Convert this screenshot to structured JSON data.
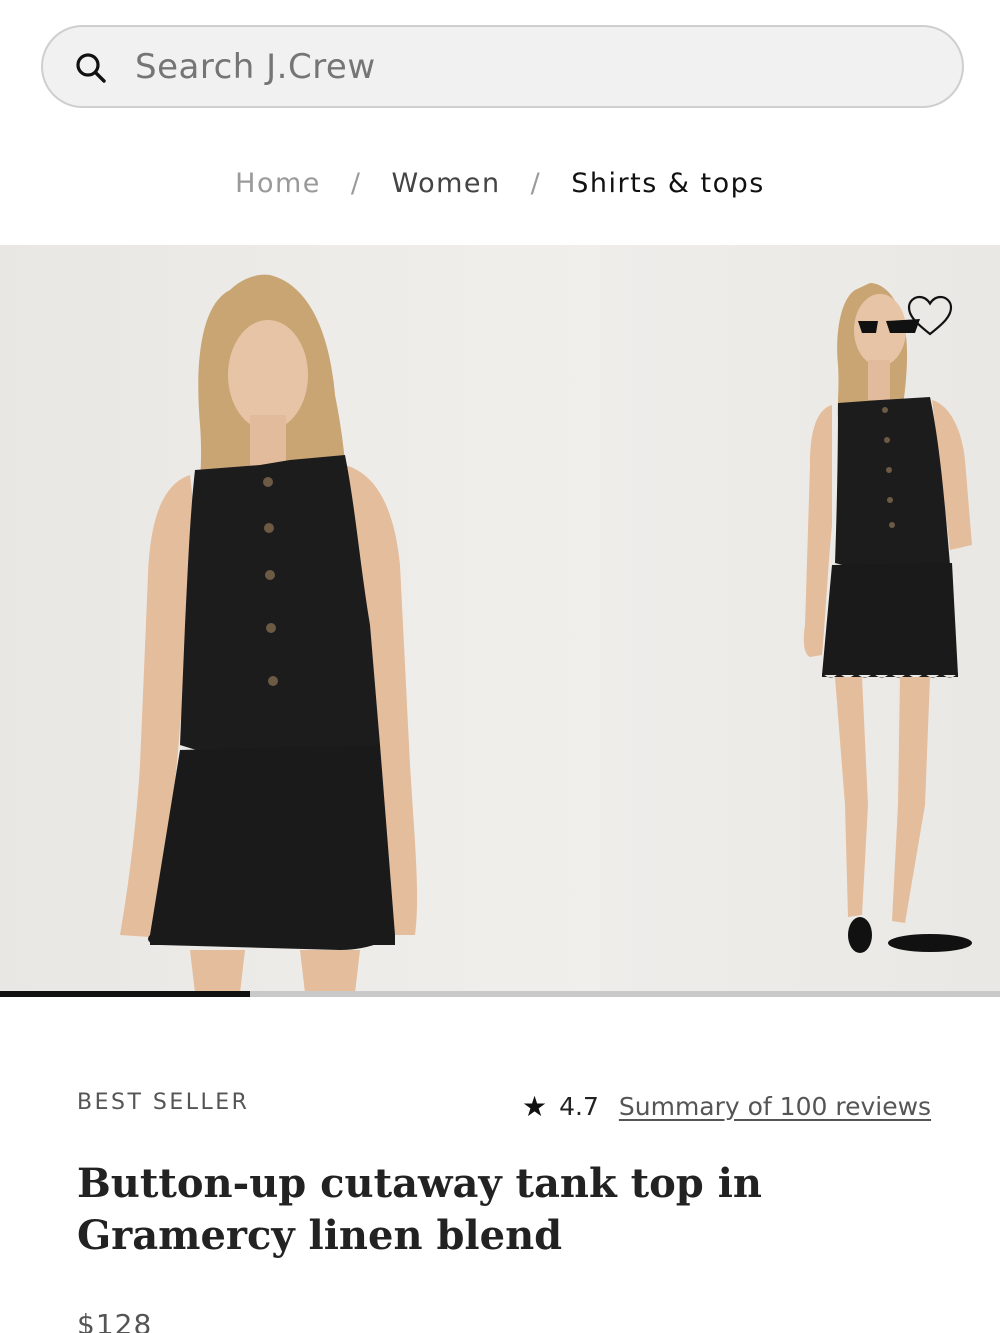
{
  "search": {
    "placeholder": "Search J.Crew",
    "icon": "search-icon"
  },
  "breadcrumb": {
    "items": [
      "Home",
      "Women",
      "Shirts & tops"
    ],
    "separator": "/"
  },
  "carousel": {
    "slides": [
      "model-front-view",
      "model-full-length-view"
    ],
    "current_fraction": 0.25,
    "colors": {
      "track": "#c9c9c9",
      "fill": "#111111"
    }
  },
  "product": {
    "badge": "BEST SELLER",
    "rating": "4.7",
    "rating_icon": "star-icon",
    "reviews_link": "Summary of 100 reviews",
    "title": "Button-up cutaway tank top in Gramercy linen blend",
    "price": "$128",
    "favorite_icon": "heart-icon"
  }
}
